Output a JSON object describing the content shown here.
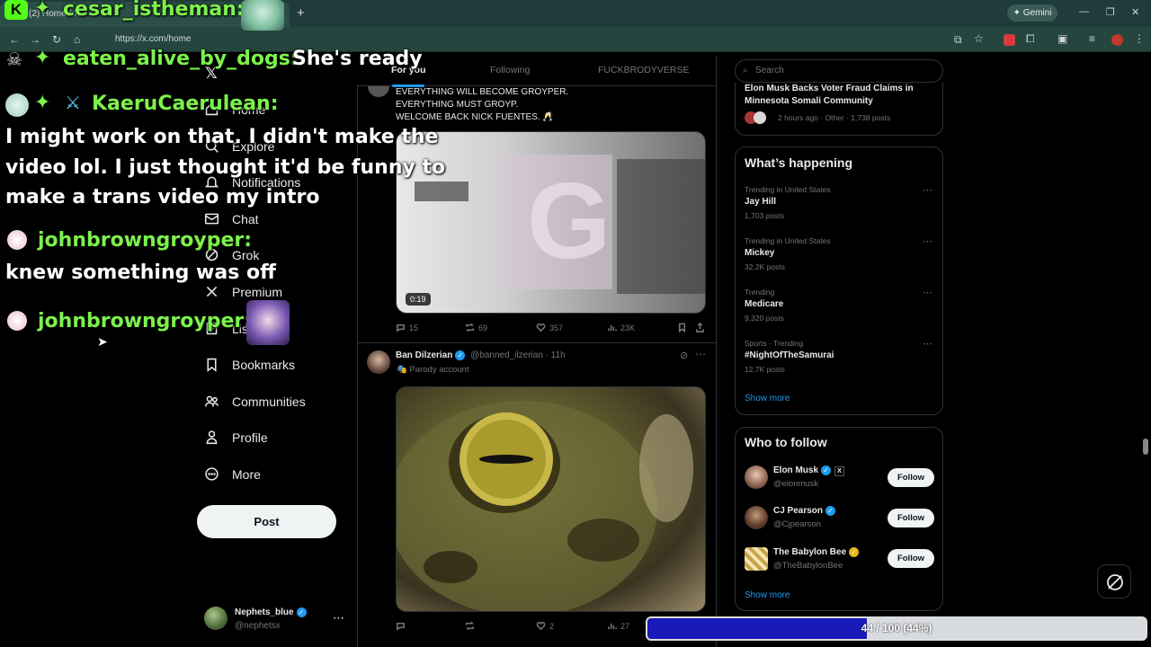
{
  "browser": {
    "tab_title": "(2) Home / X",
    "url": "https://x.com/home",
    "gemini_label": "Gemini"
  },
  "sidebar": {
    "items": [
      {
        "label": "Home",
        "icon": "home-icon"
      },
      {
        "label": "Explore",
        "icon": "search-icon"
      },
      {
        "label": "Notifications",
        "icon": "bell-icon"
      },
      {
        "label": "Chat",
        "icon": "mail-icon"
      },
      {
        "label": "Grok",
        "icon": "grok-icon"
      },
      {
        "label": "Premium",
        "icon": "x-logo-icon"
      },
      {
        "label": "Lists",
        "icon": "list-icon"
      },
      {
        "label": "Bookmarks",
        "icon": "bookmark-icon"
      },
      {
        "label": "Communities",
        "icon": "people-icon"
      },
      {
        "label": "Profile",
        "icon": "person-icon"
      },
      {
        "label": "More",
        "icon": "more-circle-icon"
      }
    ],
    "post_label": "Post",
    "account": {
      "name": "Nephets_blue",
      "handle": "@nephetsx"
    }
  },
  "feed": {
    "tabs": [
      "For you",
      "Following",
      "FUCKBRODYVERSE"
    ],
    "tweet1": {
      "lines": [
        "EVERYTHING WILL BECOME GROYPER.",
        "EVERYTHING MUST GROYP.",
        "WELCOME BACK NICK FUENTES. 🥂"
      ],
      "video_duration": "0:19",
      "replies": "15",
      "reposts": "69",
      "likes": "357",
      "views": "23K"
    },
    "tweet2": {
      "author": "Ban Dilzerian",
      "handle": "@banned_ilzerian",
      "time": "11h",
      "badge": "Parody account",
      "replies": "",
      "reposts": "",
      "likes": "2",
      "views": "27"
    }
  },
  "right": {
    "search_placeholder": "Search",
    "top_story": {
      "title": "Elon Musk Backs Voter Fraud Claims in Minnesota Somali Community",
      "meta": "2 hours ago · Other · 1,738 posts"
    },
    "whats_happening_title": "What’s happening",
    "trends": [
      {
        "context": "Trending in United States",
        "title": "Jay Hill",
        "count": "1,703 posts"
      },
      {
        "context": "Trending in United States",
        "title": "Mickey",
        "count": "32.2K posts"
      },
      {
        "context": "Trending",
        "title": "Medicare",
        "count": "9,320 posts"
      },
      {
        "context": "Sports · Trending",
        "title": "#NightOfTheSamurai",
        "count": "12.7K posts"
      }
    ],
    "show_more": "Show more",
    "who_to_follow_title": "Who to follow",
    "follow": [
      {
        "name": "Elon Musk",
        "handle": "@elonmusk"
      },
      {
        "name": "CJ Pearson",
        "handle": "@Cjpearson"
      },
      {
        "name": "The Babylon Bee",
        "handle": "@TheBabylonBee"
      }
    ],
    "follow_label": "Follow"
  },
  "chat_overlay": [
    {
      "user": "cesar_istheman:",
      "message": ""
    },
    {
      "user": "eaten_alive_by_dogs:",
      "message": "She's ready"
    },
    {
      "user": "KaeruCaerulean:",
      "message": "I might work on that. I didn't make the video lol. I just thought it'd be funny to make a trans video my intro"
    },
    {
      "user": "johnbrowngroyper:",
      "message": "knew something was off"
    },
    {
      "user": "johnbrowngroyper:",
      "message": ""
    }
  ],
  "chat_lines": {
    "kaeru_line1": "I might work on that. I didn't make the",
    "kaeru_line2": "video lol. I just thought it'd be funny to",
    "kaeru_line3": "make a trans video my intro"
  },
  "progress": {
    "value": 44,
    "max": 100,
    "fraction": 0.44,
    "label": "44 / 100 (44%)"
  },
  "colors": {
    "accent": "#1d9bf0",
    "chat_name": "#7cf24a",
    "progress_fill": "#1a1ab8",
    "browser_frame": "#1f3b3b"
  }
}
